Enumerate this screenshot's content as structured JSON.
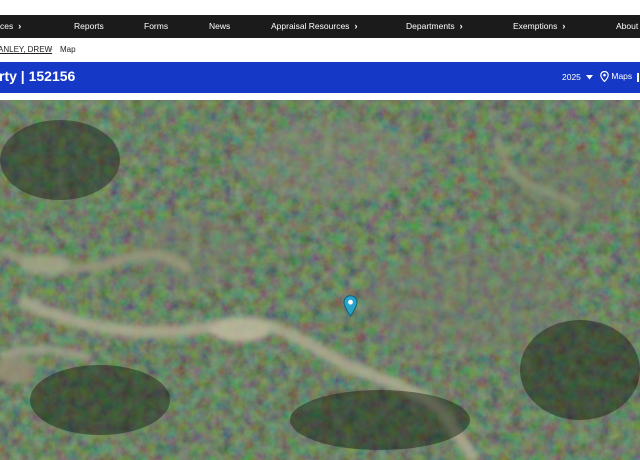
{
  "nav": {
    "items": [
      {
        "label": "ces",
        "has_chevron": true
      },
      {
        "label": "Reports",
        "has_chevron": false
      },
      {
        "label": "Forms",
        "has_chevron": false
      },
      {
        "label": "News",
        "has_chevron": false
      },
      {
        "label": "Appraisal Resources",
        "has_chevron": true
      },
      {
        "label": "Departments",
        "has_chevron": true
      },
      {
        "label": "Exemptions",
        "has_chevron": true
      },
      {
        "label": "About",
        "has_chevron": false
      }
    ],
    "chevron_glyph": "›"
  },
  "breadcrumb": {
    "owner": "ANLEY, DREW",
    "separator": ">",
    "current": "Map"
  },
  "property_banner": {
    "title": "rty | 152156",
    "year": "2025",
    "year_dropdown_icon": "caret-down-icon",
    "maps_label": "Maps",
    "maps_icon": "map-pin-icon"
  },
  "map": {
    "type": "satellite imagery",
    "marker_icon": "location-pin-icon",
    "marker_color": "#2aa3c8"
  },
  "colors": {
    "nav_bg": "#1b1b1b",
    "banner_bg": "#1538c6",
    "text_light": "#ffffff"
  }
}
